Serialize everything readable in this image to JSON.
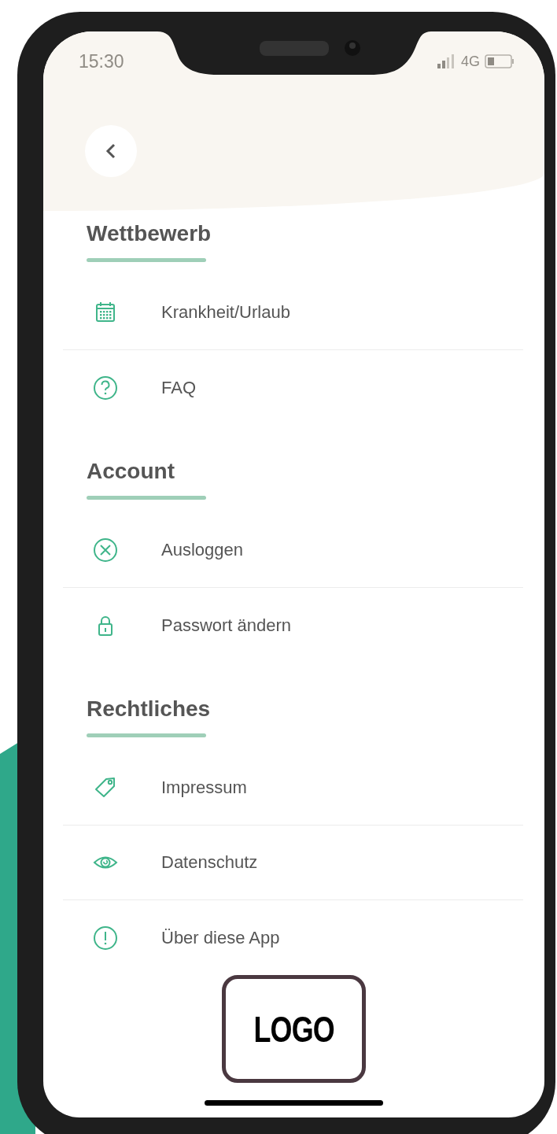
{
  "status_bar": {
    "time": "15:30",
    "network": "4G"
  },
  "sections": [
    {
      "title": "Wettbewerb",
      "items": [
        {
          "label": "Krankheit/Urlaub",
          "kind": "calendar"
        },
        {
          "label": "FAQ",
          "kind": "question"
        }
      ]
    },
    {
      "title": "Account",
      "items": [
        {
          "label": "Ausloggen",
          "kind": "cross"
        },
        {
          "label": "Passwort ändern",
          "kind": "lock"
        }
      ]
    },
    {
      "title": "Rechtliches",
      "items": [
        {
          "label": "Impressum",
          "kind": "tag"
        },
        {
          "label": "Datenschutz",
          "kind": "eye"
        },
        {
          "label": "Über diese App",
          "kind": "exclamation"
        }
      ]
    }
  ],
  "logo": {
    "text": "LOGO"
  }
}
